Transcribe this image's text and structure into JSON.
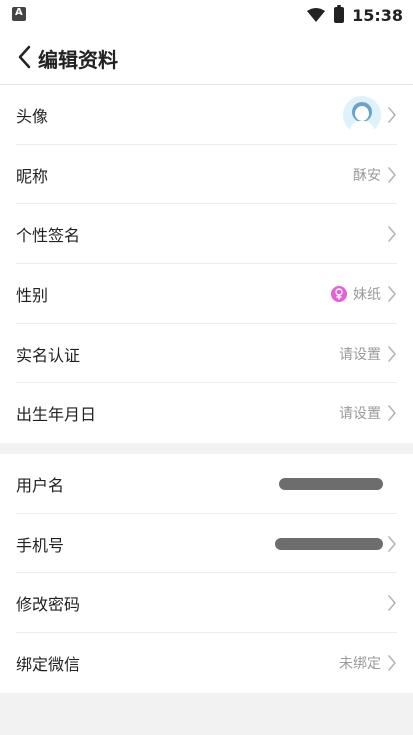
{
  "status_bar": {
    "time": "15:38",
    "left_icon": "a-icon",
    "wifi_icon": "wifi-icon",
    "battery_icon": "battery-icon"
  },
  "nav": {
    "title": "编辑资料",
    "back_icon": "chevron-left-icon"
  },
  "profile_items": [
    {
      "key": "avatar",
      "label": "头像",
      "value": ""
    },
    {
      "key": "nickname",
      "label": "昵称",
      "value": "酥安"
    },
    {
      "key": "signature",
      "label": "个性签名",
      "value": ""
    },
    {
      "key": "gender",
      "label": "性别",
      "value": "妹纸",
      "icon": "female-icon",
      "icon_color": "#e85fd6"
    },
    {
      "key": "real_name",
      "label": "实名认证",
      "value": "请设置"
    },
    {
      "key": "birthday",
      "label": "出生年月日",
      "value": "请设置"
    }
  ],
  "account_items": [
    {
      "key": "username",
      "label": "用户名",
      "value": "",
      "redacted": true
    },
    {
      "key": "phone",
      "label": "手机号",
      "value": "",
      "redacted": true
    },
    {
      "key": "password",
      "label": "修改密码",
      "value": ""
    },
    {
      "key": "wechat",
      "label": "绑定微信",
      "value": "未绑定"
    }
  ],
  "colors": {
    "background": "#f2f2f2",
    "card": "#ffffff",
    "muted_text": "#9b9b9b",
    "divider": "#ececec",
    "female_badge": "#e85fd6"
  }
}
